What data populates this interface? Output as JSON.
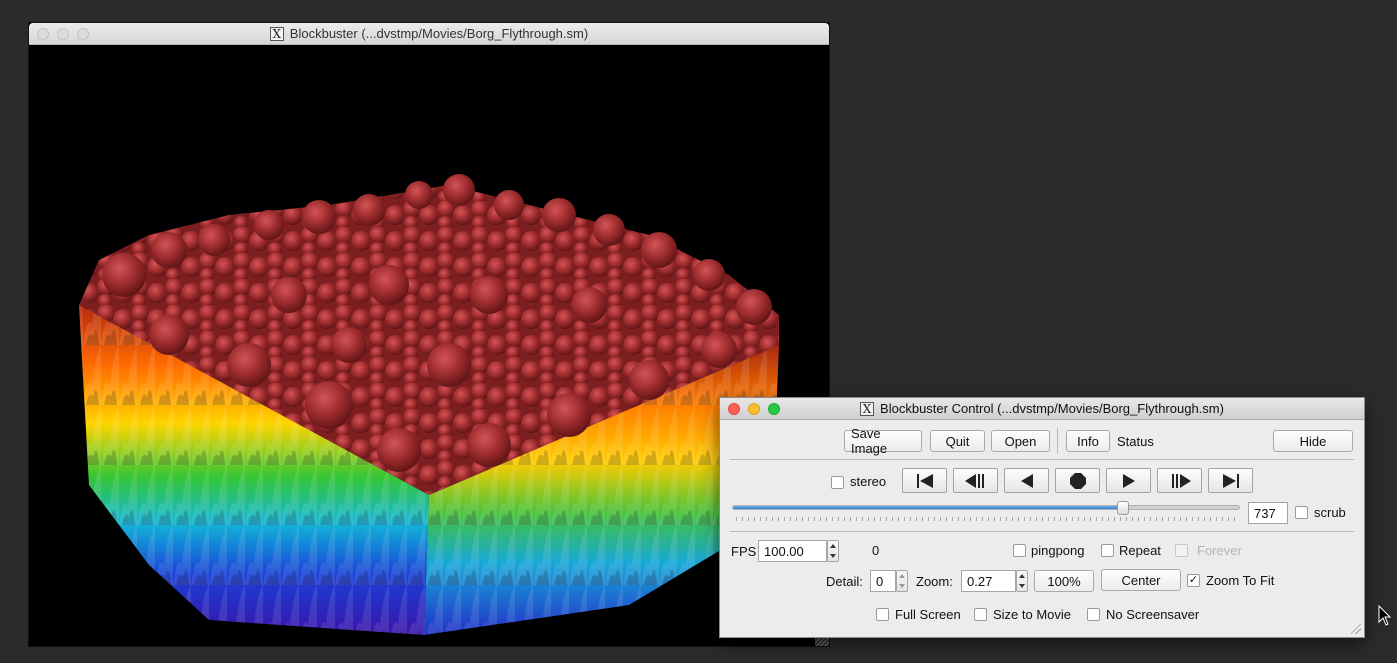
{
  "movie_window": {
    "title": "Blockbuster (...dvstmp/Movies/Borg_Flythrough.sm)",
    "title_icon": "x11-icon"
  },
  "control_window": {
    "title": "Blockbuster Control (...dvstmp/Movies/Borg_Flythrough.sm)",
    "title_icon": "x11-icon",
    "buttons": {
      "save_image": "Save Image",
      "quit": "Quit",
      "open": "Open",
      "info": "Info",
      "hide": "Hide",
      "zoom_100": "100%",
      "center": "Center"
    },
    "status_label": "Status",
    "stereo_label": "stereo",
    "transport_icons": [
      "skip-to-start-icon",
      "step-back-icon",
      "play-reverse-icon",
      "stop-icon",
      "play-icon",
      "step-forward-icon",
      "skip-to-end-icon"
    ],
    "frame_slider": {
      "value_fraction": 0.77
    },
    "frame_value": "737",
    "scrub_label": "scrub",
    "fps_label": "FPS",
    "fps_value": "100.00",
    "frame_counter": "0",
    "pingpong_label": "pingpong",
    "repeat_label": "Repeat",
    "forever_label": "Forever",
    "detail_label": "Detail:",
    "detail_value": "0",
    "zoom_label": "Zoom:",
    "zoom_value": "0.27",
    "zoom_to_fit_label": "Zoom To Fit",
    "zoom_to_fit_checked": "✓",
    "full_screen_label": "Full Screen",
    "size_to_movie_label": "Size to Movie",
    "no_screensaver_label": "No Screensaver"
  },
  "colors": {
    "desktop": "#2b2b2b",
    "window_bg": "#ececec",
    "slider_blue": "#2f7fd6"
  }
}
